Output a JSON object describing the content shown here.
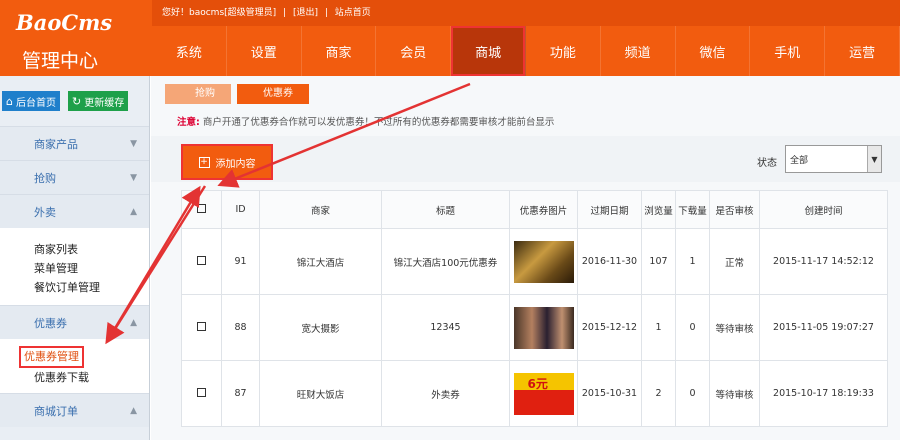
{
  "logo": {
    "brand": "BaoCms",
    "subtitle": "管理中心"
  },
  "topbar": {
    "greeting": "您好！baocms[超级管理员]",
    "sep1": "|",
    "logout": "[退出]",
    "sep2": "|",
    "home": "站点首页"
  },
  "nav": [
    "系统",
    "设置",
    "商家",
    "会员",
    "商城",
    "功能",
    "频道",
    "微信",
    "手机",
    "运营"
  ],
  "quick": {
    "home": "后台首页",
    "refresh": "更新缓存"
  },
  "sidebar": {
    "s1": "商家产品",
    "s2": "抢购",
    "s3": "外卖",
    "takeout": [
      "商家列表",
      "菜单管理",
      "餐饮订单管理"
    ],
    "s4": "优惠券",
    "coupon": [
      "优惠券管理",
      "优惠券下载"
    ],
    "s5": "商城订单"
  },
  "breadcrumb": [
    "抢购",
    "优惠券"
  ],
  "notice": {
    "label": "注意:",
    "text": "商户开通了优惠券合作就可以发优惠券！不过所有的优惠券都需要审核才能前台显示"
  },
  "toolbar": {
    "add": "添加内容",
    "status_label": "状态",
    "status_value": "全部"
  },
  "table": {
    "headers": [
      "ID",
      "商家",
      "标题",
      "优惠券图片",
      "过期日期",
      "浏览量",
      "下载量",
      "是否审核",
      "创建时间"
    ],
    "rows": [
      {
        "id": "91",
        "shop": "锦江大酒店",
        "title": "锦江大酒店100元优惠券",
        "expire": "2016-11-30",
        "views": "107",
        "downloads": "1",
        "audit": "正常",
        "created": "2015-11-17 14:52:12"
      },
      {
        "id": "88",
        "shop": "宽大摄影",
        "title": "12345",
        "expire": "2015-12-12",
        "views": "1",
        "downloads": "0",
        "audit": "等待审核",
        "created": "2015-11-05 19:07:27"
      },
      {
        "id": "87",
        "shop": "旺财大饭店",
        "title": "外卖券",
        "expire": "2015-10-31",
        "views": "2",
        "downloads": "0",
        "audit": "等待审核",
        "created": "2015-10-17 18:19:33"
      }
    ],
    "thumb3_text": "6元"
  },
  "colors": {
    "brand": "#f25c0f",
    "highlight": "#e33333"
  }
}
